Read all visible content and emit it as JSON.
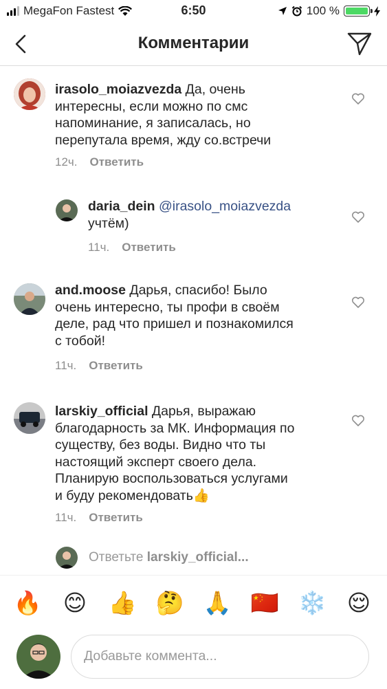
{
  "status_bar": {
    "carrier": "MegaFon Fastest",
    "time": "6:50",
    "battery": "100 %",
    "battery_level": 1.0
  },
  "header": {
    "title": "Комментарии"
  },
  "comments": [
    {
      "username": "irasolo_moiazvezda",
      "text_lines": [
        "Да, очень",
        "интересны, если можно по смс",
        "напоминание, я записалась, но",
        "перепутала время, жду со.встречи"
      ],
      "time": "12ч.",
      "reply_label": "Ответить"
    },
    {
      "username": "daria_dein",
      "mention": "@irasolo_moiazvezda",
      "text_lines": [
        "учтём)"
      ],
      "time": "11ч.",
      "reply_label": "Ответить"
    },
    {
      "username": "and.moose",
      "text_lines": [
        "Дарья, спасибо! Было",
        "очень интересно, ты профи в своём",
        "деле, рад что пришел и познакомился",
        "с тобой!"
      ],
      "time": "11ч.",
      "reply_label": "Ответить"
    },
    {
      "username": "larskiy_official",
      "text_lines": [
        "Дарья, выражаю",
        "благодарность за МК.  Информация по",
        "существу, без воды. Видно что ты",
        "настоящий эксперт своего дела.",
        "Планирую воспользоваться услугами",
        "и буду рекомендовать👍"
      ],
      "time": "11ч.",
      "reply_label": "Ответить"
    }
  ],
  "reply_prompt": {
    "prefix": "Ответьте",
    "username": "larskiy_official..."
  },
  "emojis": [
    "🔥",
    "😊",
    "👍",
    "🤔",
    "🙏",
    "🇨🇳",
    "❄️",
    "😌"
  ],
  "composer": {
    "placeholder": "Добавьте коммента..."
  },
  "colors": {
    "mention": "#385185",
    "secondary_text": "#8e8e8e",
    "battery": "#4cd964"
  }
}
